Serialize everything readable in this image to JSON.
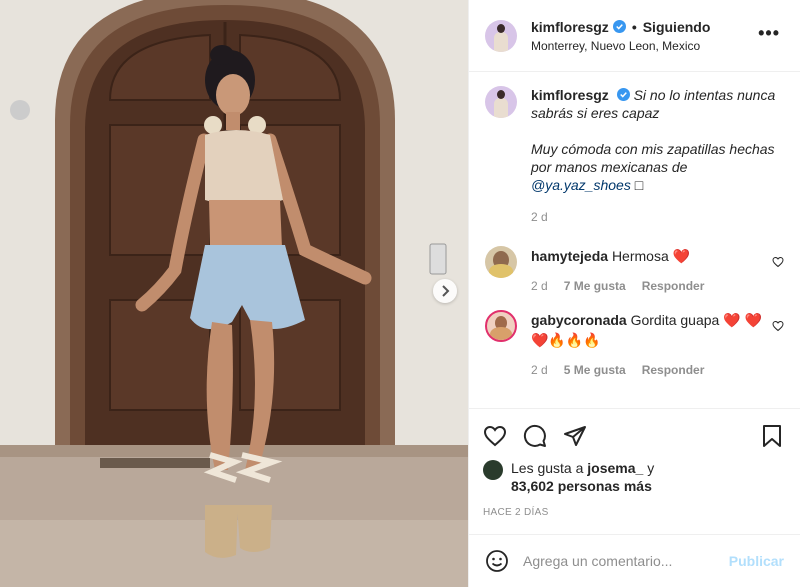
{
  "post": {
    "username": "kimfloresgz",
    "follow_state": "Siguiendo",
    "location": "Monterrey, Nuevo Leon, Mexico",
    "more_label": "•••"
  },
  "caption": {
    "username": "kimfloresgz",
    "line1": "Si no lo intentas nunca sabrás si eres capaz",
    "line2": "Muy cómoda con mis zapatillas hechas por manos mexicanas de",
    "mention": "@ya.yaz_shoes",
    "trailing": " □",
    "time": "2 d"
  },
  "comments": [
    {
      "username": "hamytejeda",
      "text": "Hermosa ❤️",
      "time": "2 d",
      "likes": "7 Me gusta",
      "reply": "Responder"
    },
    {
      "username": "gabycoronada",
      "text": "Gordita guapa ❤️ ❤️❤️🔥🔥🔥",
      "time": "2 d",
      "likes": "5 Me gusta",
      "reply": "Responder"
    }
  ],
  "likes": {
    "prefix": "Les gusta a ",
    "user": "josema_",
    "suffix": " y",
    "count": "83,602 personas más"
  },
  "posted_ago": "HACE 2 DÍAS",
  "add_comment": {
    "placeholder": "Agrega un comentario...",
    "publish": "Publicar"
  },
  "icons": [
    "heart-icon",
    "comment-icon",
    "share-icon",
    "bookmark-icon",
    "emoji-icon",
    "verified-icon",
    "chevron-right-icon"
  ],
  "colors": {
    "verified": "#3897f0",
    "link": "#00376b",
    "publish_disabled": "#b2dffc",
    "heart": "#ed4956"
  }
}
